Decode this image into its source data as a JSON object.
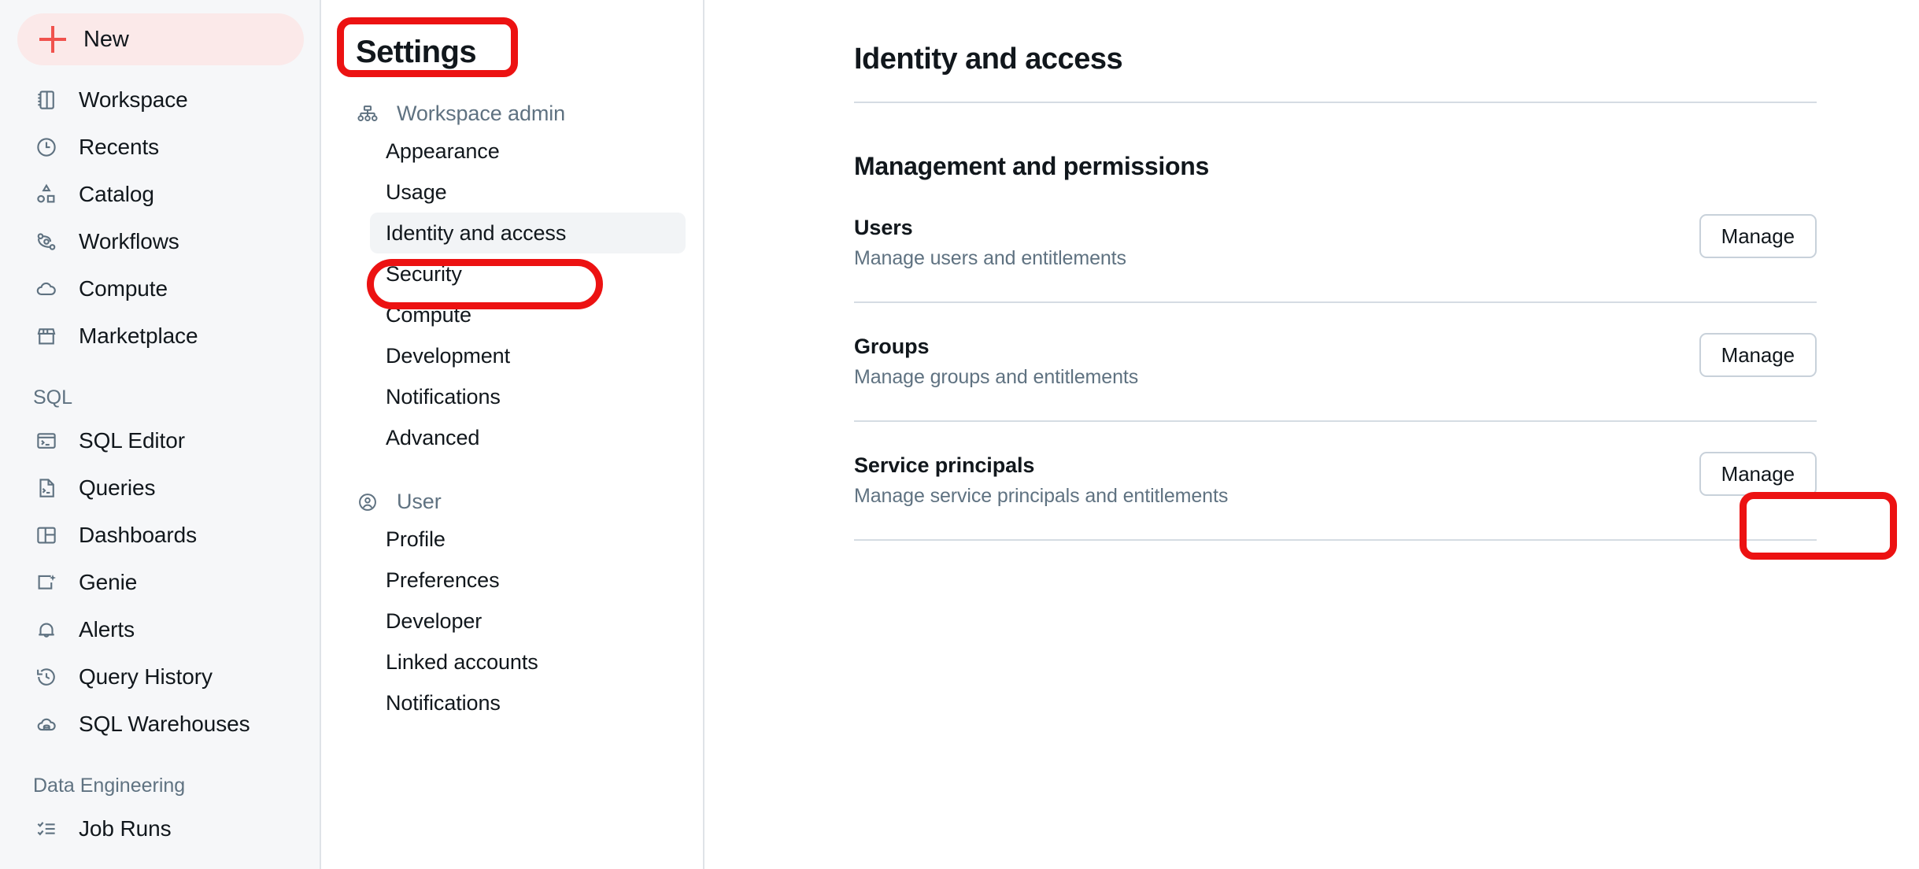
{
  "sidebar": {
    "new_button": {
      "label": "New",
      "icon": "plus-icon"
    },
    "items": [
      {
        "label": "Workspace",
        "icon": "workspace-icon"
      },
      {
        "label": "Recents",
        "icon": "clock-icon"
      },
      {
        "label": "Catalog",
        "icon": "catalog-icon"
      },
      {
        "label": "Workflows",
        "icon": "workflows-icon"
      },
      {
        "label": "Compute",
        "icon": "cloud-icon"
      },
      {
        "label": "Marketplace",
        "icon": "storefront-icon"
      }
    ],
    "sections": [
      {
        "title": "SQL",
        "items": [
          {
            "label": "SQL Editor",
            "icon": "sql-editor-icon"
          },
          {
            "label": "Queries",
            "icon": "queries-icon"
          },
          {
            "label": "Dashboards",
            "icon": "dashboards-icon"
          },
          {
            "label": "Genie",
            "icon": "genie-icon"
          },
          {
            "label": "Alerts",
            "icon": "bell-icon"
          },
          {
            "label": "Query History",
            "icon": "history-icon"
          },
          {
            "label": "SQL Warehouses",
            "icon": "warehouse-icon"
          }
        ]
      },
      {
        "title": "Data Engineering",
        "items": [
          {
            "label": "Job Runs",
            "icon": "job-runs-icon"
          }
        ]
      }
    ]
  },
  "settings": {
    "title": "Settings",
    "groups": [
      {
        "label": "Workspace admin",
        "icon": "org-chart-icon",
        "items": [
          {
            "label": "Appearance",
            "active": false
          },
          {
            "label": "Usage",
            "active": false
          },
          {
            "label": "Identity and access",
            "active": true
          },
          {
            "label": "Security",
            "active": false
          },
          {
            "label": "Compute",
            "active": false
          },
          {
            "label": "Development",
            "active": false
          },
          {
            "label": "Notifications",
            "active": false
          },
          {
            "label": "Advanced",
            "active": false
          }
        ]
      },
      {
        "label": "User",
        "icon": "user-circle-icon",
        "items": [
          {
            "label": "Profile",
            "active": false
          },
          {
            "label": "Preferences",
            "active": false
          },
          {
            "label": "Developer",
            "active": false
          },
          {
            "label": "Linked accounts",
            "active": false
          },
          {
            "label": "Notifications",
            "active": false
          }
        ]
      }
    ]
  },
  "main": {
    "page_title": "Identity and access",
    "section_title": "Management and permissions",
    "rows": [
      {
        "name": "Users",
        "desc": "Manage users and entitlements",
        "action": "Manage"
      },
      {
        "name": "Groups",
        "desc": "Manage groups and entitlements",
        "action": "Manage"
      },
      {
        "name": "Service principals",
        "desc": "Manage service principals and entitlements",
        "action": "Manage"
      }
    ]
  },
  "annotations": {
    "color": "#ec1212",
    "boxes": [
      {
        "target": "settings-title"
      },
      {
        "target": "settings-item-identity-and-access"
      },
      {
        "target": "manage-button-service-principals"
      }
    ]
  }
}
